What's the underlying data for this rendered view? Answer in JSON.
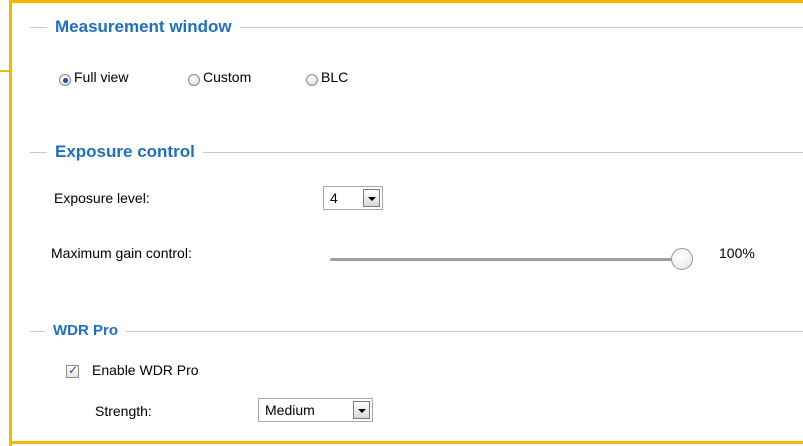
{
  "measurement_window": {
    "title": "Measurement window",
    "options": [
      {
        "label": "Full view",
        "selected": true
      },
      {
        "label": "Custom",
        "selected": false
      },
      {
        "label": "BLC",
        "selected": false
      }
    ]
  },
  "exposure_control": {
    "title": "Exposure control",
    "exposure_level_label": "Exposure level:",
    "exposure_level_value": "4",
    "max_gain_label": "Maximum gain control:",
    "max_gain_value": "100%",
    "max_gain_percent": 100
  },
  "wdr_pro": {
    "title": "WDR Pro",
    "enable_label": "Enable WDR Pro",
    "enabled": true,
    "strength_label": "Strength:",
    "strength_value": "Medium"
  },
  "colors": {
    "highlight_frame": "#f5b800",
    "section_title": "#1f6fc1",
    "radio_dot": "#1f4f9c"
  }
}
